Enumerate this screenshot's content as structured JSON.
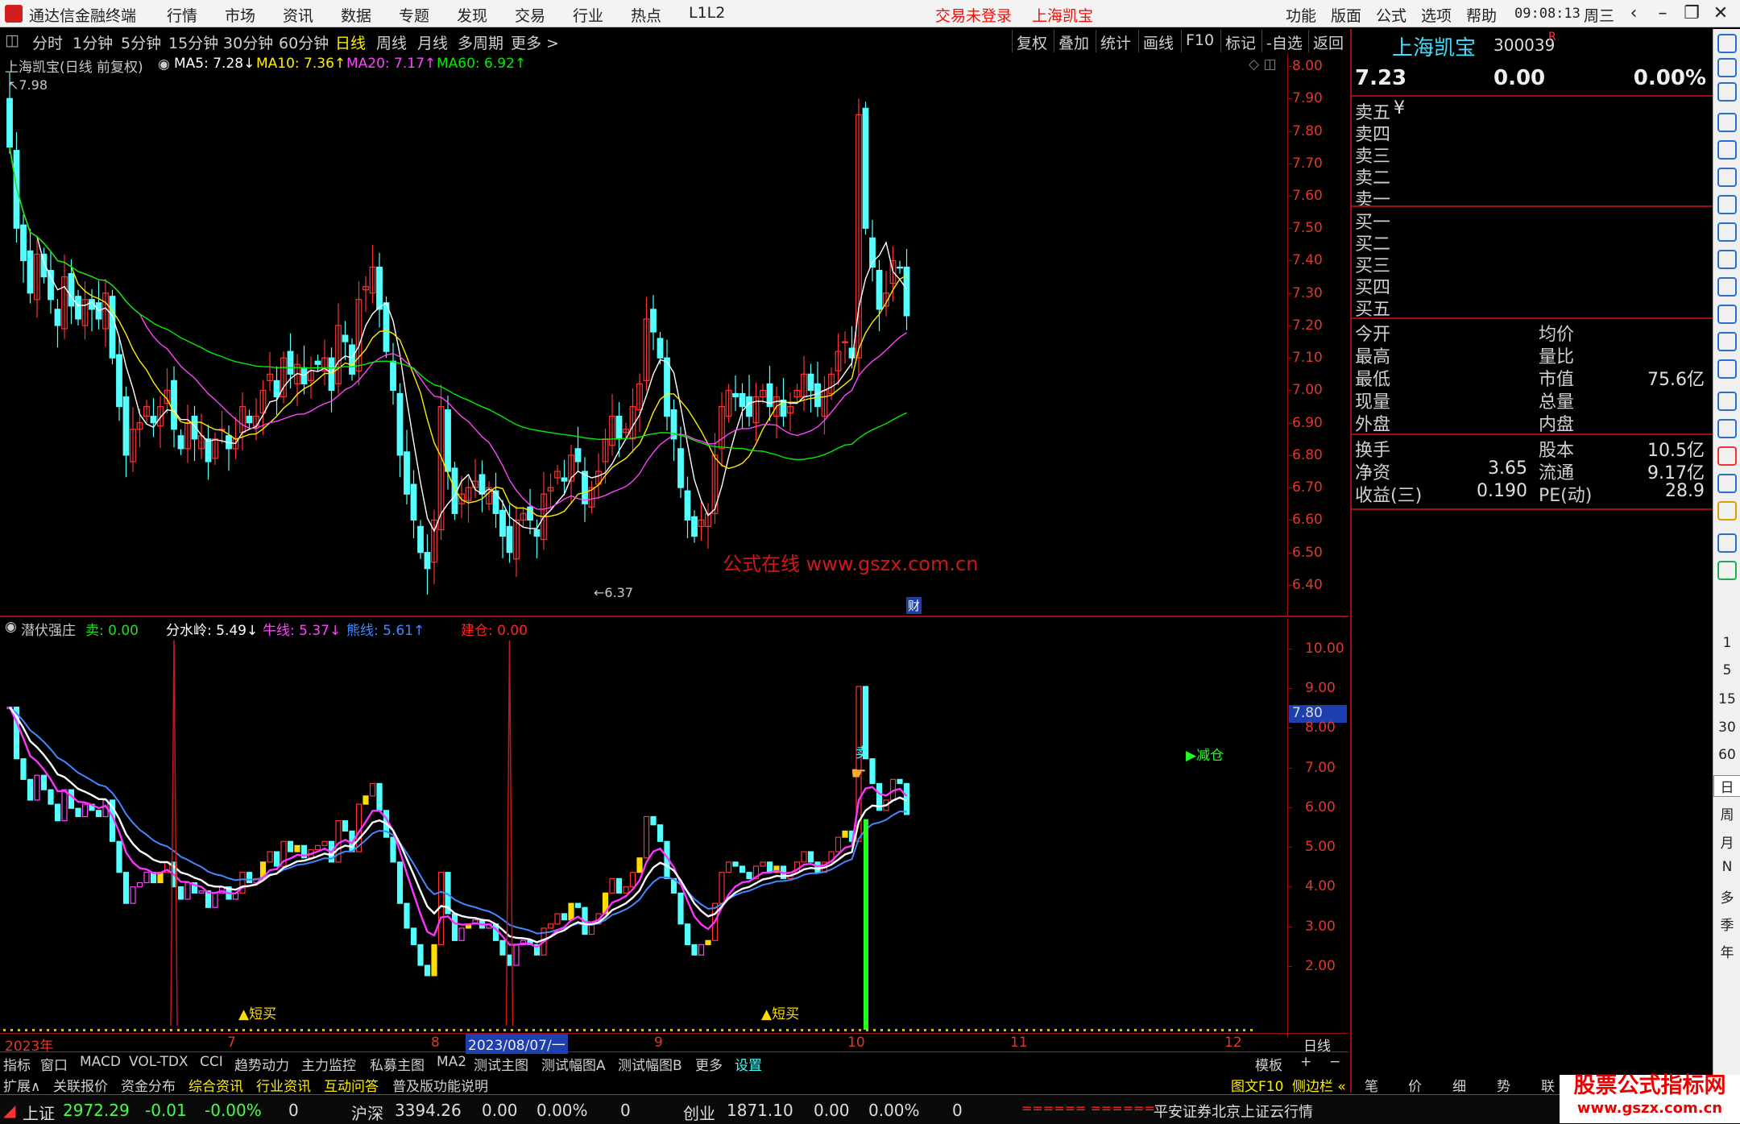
{
  "titlebar": {
    "app_name": "通达信金融终端",
    "menus": [
      "行情",
      "市场",
      "资讯",
      "数据",
      "专题",
      "发现",
      "交易",
      "行业",
      "热点",
      "L1L2"
    ],
    "login_status": "交易未登录",
    "stock_name": "上海凯宝",
    "right_menus": [
      "功能",
      "版面",
      "公式",
      "选项",
      "帮助"
    ],
    "time": "09:08:13",
    "weekday": "周三"
  },
  "tabbar": {
    "periods": [
      "分时",
      "1分钟",
      "5分钟",
      "15分钟",
      "30分钟",
      "60分钟",
      "日线",
      "周线",
      "月线",
      "多周期",
      "更多 >"
    ],
    "active": "日线",
    "tools": [
      "复权",
      "叠加",
      "统计",
      "画线",
      "F10",
      "标记",
      "-自选",
      "返回"
    ]
  },
  "main": {
    "title": "上海凯宝(日线 前复权)",
    "ma5": "MA5: 7.28↓",
    "ma10": "MA10: 7.36↑",
    "ma20": "MA20: 7.17↑",
    "ma60": "MA60: 6.92↑",
    "high_mark": "7.98",
    "low_mark": "6.37",
    "cai_mark": "财",
    "watermark": "公式在线  www.gszx.com.cn",
    "y_ticks": [
      "8.00",
      "7.90",
      "7.80",
      "7.70",
      "7.60",
      "7.50",
      "7.40",
      "7.30",
      "7.20",
      "7.10",
      "7.00",
      "6.90",
      "6.80",
      "6.70",
      "6.60",
      "6.50",
      "6.40"
    ]
  },
  "sub": {
    "title": "潜伏强庄",
    "sell": "卖: 0.00",
    "fsl": "分水岭: 5.49↓",
    "niu": "牛线: 5.37↓",
    "xiong": "熊线: 5.61↑",
    "jiancang": "建仓: 0.00",
    "y_ticks": [
      "10.00",
      "9.00",
      "8.00",
      "7.00",
      "6.00",
      "5.00",
      "4.00",
      "3.00",
      "2.00"
    ],
    "cursor_value": "7.80",
    "sell_label": "卖",
    "reduce_label": "减仓",
    "buy_label1": "▲短买",
    "buy_label2": "▲短买"
  },
  "xaxis": {
    "labels": [
      "2023年",
      "7",
      "8",
      "2023/08/07/一",
      "9",
      "10",
      "11",
      "12"
    ],
    "period": "日线"
  },
  "bottom_tabs1": [
    "指标",
    "窗口",
    "MACD",
    "VOL-TDX",
    "CCI",
    "趋势动力",
    "主力监控",
    "私募主图",
    "MA2",
    "测试主图",
    "测试幅图A",
    "测试幅图B",
    "更多",
    "设置"
  ],
  "bottom_tabs1_right": [
    "模板",
    "+",
    "−"
  ],
  "bottom_tabs2": [
    "扩展∧",
    "关联报价",
    "资金分布",
    "综合资讯",
    "行业资讯",
    "互动问答",
    "普及版功能说明"
  ],
  "bottom_tabs2_right": [
    "图文F10",
    "侧边栏 «",
    "笔",
    "价",
    "细",
    "势",
    "联"
  ],
  "quote": {
    "name": "上海凯宝",
    "code": "300039",
    "r": "R",
    "price": "7.23",
    "change": "0.00",
    "pct": "0.00%",
    "asks": [
      "卖五",
      "卖四",
      "卖三",
      "卖二",
      "卖一"
    ],
    "bids": [
      "买一",
      "买二",
      "买三",
      "买四",
      "买五"
    ],
    "yen": "¥",
    "rows": [
      [
        "今开",
        "",
        "均价",
        ""
      ],
      [
        "最高",
        "",
        "量比",
        ""
      ],
      [
        "最低",
        "",
        "市值",
        "75.6亿"
      ],
      [
        "现量",
        "",
        "总量",
        ""
      ],
      [
        "外盘",
        "",
        "内盘",
        ""
      ]
    ],
    "rows2": [
      [
        "换手",
        "",
        "股本",
        "10.5亿"
      ],
      [
        "净资",
        "3.65",
        "流通",
        "9.17亿"
      ],
      [
        "收益(三)",
        "0.190",
        "PE(动)",
        "28.9"
      ]
    ]
  },
  "status": {
    "sh_name": "上证",
    "sh_val": "2972.29",
    "sh_chg": "-0.01",
    "sh_pct": "-0.00%",
    "sh_vol": "0",
    "hs_name": "沪深",
    "hs_val": "3394.26",
    "hs_chg": "0.00",
    "hs_pct": "0.00%",
    "hs_vol": "0",
    "cy_name": "创业",
    "cy_val": "1871.10",
    "cy_chg": "0.00",
    "cy_pct": "0.00%",
    "cy_vol": "0",
    "bars": "====== ======",
    "server": "平安证券北京上证云行情"
  },
  "sidebar": {
    "items": [
      "1",
      "5",
      "15",
      "30",
      "60",
      "日",
      "周",
      "月",
      "N",
      "多",
      "季",
      "年"
    ]
  },
  "corner_watermark": {
    "line1": "股票公式指标网",
    "line2": "www.gszx.com.cn"
  },
  "colors": {
    "up": "#ff3333",
    "down": "#54ffff",
    "ma5": "#ffffff",
    "ma10": "#ffee00",
    "ma20": "#ff44ff",
    "ma60": "#00ee00",
    "axis": "#9a1010",
    "yellow": "#ffdd00",
    "green_bar": "#22ff22",
    "blue_line": "#4488ff"
  },
  "chart_data": {
    "type": "candlestick",
    "title": "上海凯宝(日线 前复权)",
    "ylim": [
      6.35,
      8.02
    ],
    "closes": [
      7.75,
      7.5,
      7.4,
      7.3,
      7.42,
      7.35,
      7.28,
      7.2,
      7.35,
      7.26,
      7.22,
      7.28,
      7.25,
      7.22,
      7.3,
      7.1,
      6.95,
      6.8,
      6.88,
      6.9,
      6.95,
      6.9,
      6.95,
      7.0,
      6.88,
      6.82,
      6.9,
      6.85,
      6.86,
      6.78,
      6.85,
      6.88,
      6.82,
      6.85,
      6.95,
      6.9,
      6.92,
      7.0,
      7.05,
      6.98,
      7.1,
      7.05,
      7.08,
      7.02,
      7.06,
      7.08,
      7.1,
      7.0,
      7.2,
      7.15,
      7.05,
      7.28,
      7.32,
      7.38,
      7.25,
      7.12,
      7.0,
      6.8,
      6.68,
      6.6,
      6.5,
      6.45,
      6.6,
      6.95,
      6.75,
      6.62,
      6.68,
      6.7,
      6.72,
      6.68,
      6.7,
      6.62,
      6.55,
      6.5,
      6.6,
      6.62,
      6.6,
      6.55,
      6.68,
      6.7,
      6.75,
      6.72,
      6.8,
      6.78,
      6.65,
      6.7,
      6.75,
      6.85,
      6.92,
      6.85,
      6.88,
      6.95,
      7.02,
      7.22,
      7.18,
      7.1,
      6.92,
      6.85,
      6.7,
      6.6,
      6.55,
      6.6,
      6.62,
      6.8,
      6.95,
      7.0,
      6.98,
      6.95,
      6.92,
      6.98,
      7.0,
      6.95,
      6.98,
      6.92,
      6.95,
      7.0,
      7.05,
      7.0,
      6.95,
      7.0,
      7.05,
      7.12,
      7.15,
      7.1,
      7.85,
      7.5,
      7.38,
      7.25,
      7.3,
      7.4,
      7.38,
      7.23
    ],
    "series": [
      {
        "name": "MA5"
      },
      {
        "name": "MA10"
      },
      {
        "name": "MA20"
      },
      {
        "name": "MA60"
      }
    ]
  }
}
